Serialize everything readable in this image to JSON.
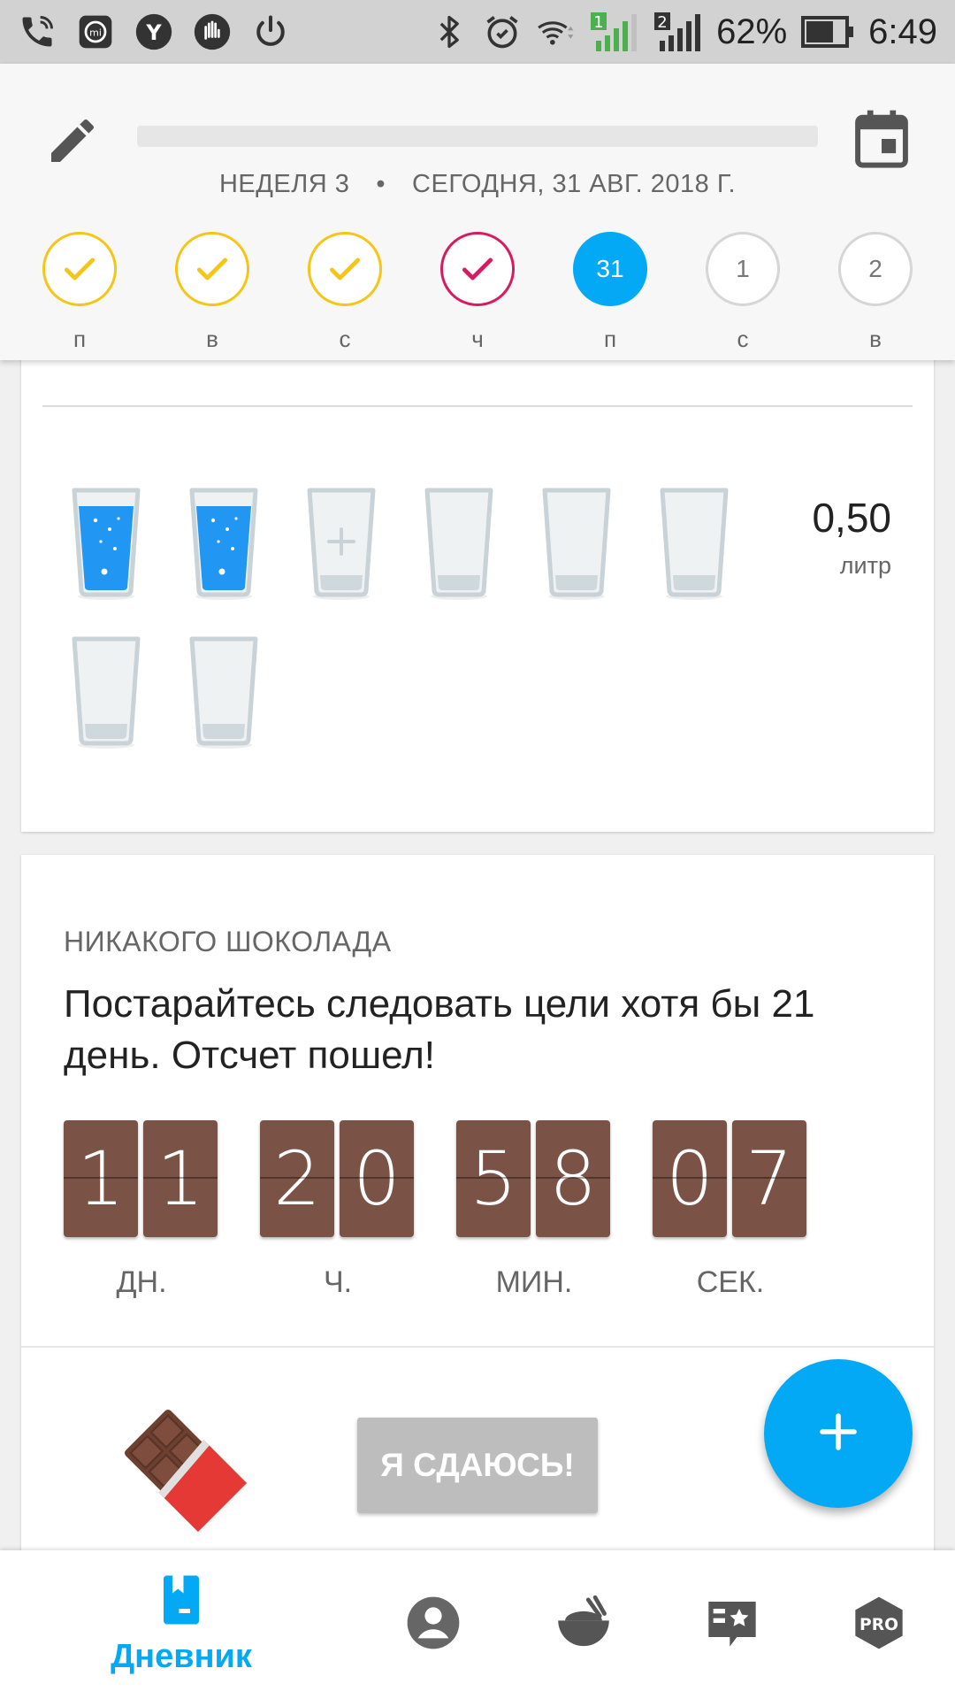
{
  "status_bar": {
    "battery": "62%",
    "time": "6:49",
    "sim1": "1",
    "sim2": "2",
    "icons": [
      "phone-wifi-icon",
      "mi-icon",
      "yandex-icon",
      "hand-icon",
      "power-icon",
      "bluetooth-icon",
      "alarm-icon",
      "wifi-icon",
      "signal-icon",
      "battery-icon"
    ]
  },
  "header": {
    "week": "НЕДЕЛЯ 3",
    "separator": "•",
    "date": "СЕГОДНЯ, 31 АВГ. 2018 Г.",
    "days": [
      {
        "label": "п",
        "state": "done",
        "number": ""
      },
      {
        "label": "в",
        "state": "done",
        "number": ""
      },
      {
        "label": "с",
        "state": "done",
        "number": ""
      },
      {
        "label": "ч",
        "state": "missed",
        "number": ""
      },
      {
        "label": "п",
        "state": "today",
        "number": "31"
      },
      {
        "label": "с",
        "state": "future",
        "number": "1"
      },
      {
        "label": "в",
        "state": "future",
        "number": "2"
      }
    ]
  },
  "water": {
    "value": "0,50",
    "unit": "литр",
    "glasses_filled": 2,
    "glasses_total": 8
  },
  "goal": {
    "title": "НИКАКОГО ШОКОЛАДА",
    "text": "Постарайтесь следовать цели хотя бы 21 день. Отсчет пошел!",
    "timer": [
      {
        "digits": [
          "1",
          "1"
        ],
        "unit": "ДН."
      },
      {
        "digits": [
          "2",
          "0"
        ],
        "unit": "Ч."
      },
      {
        "digits": [
          "5",
          "8"
        ],
        "unit": "МИН."
      },
      {
        "digits": [
          "0",
          "7"
        ],
        "unit": "СЕК."
      }
    ],
    "give_up_label": "Я СДАЮСЬ!"
  },
  "nav": {
    "diary_label": "Дневник",
    "accent": "#03a9f4"
  },
  "colors": {
    "accent": "#03a9f4",
    "done": "#f5c517",
    "missed": "#d81b60",
    "chocolate": "#7b5246"
  }
}
